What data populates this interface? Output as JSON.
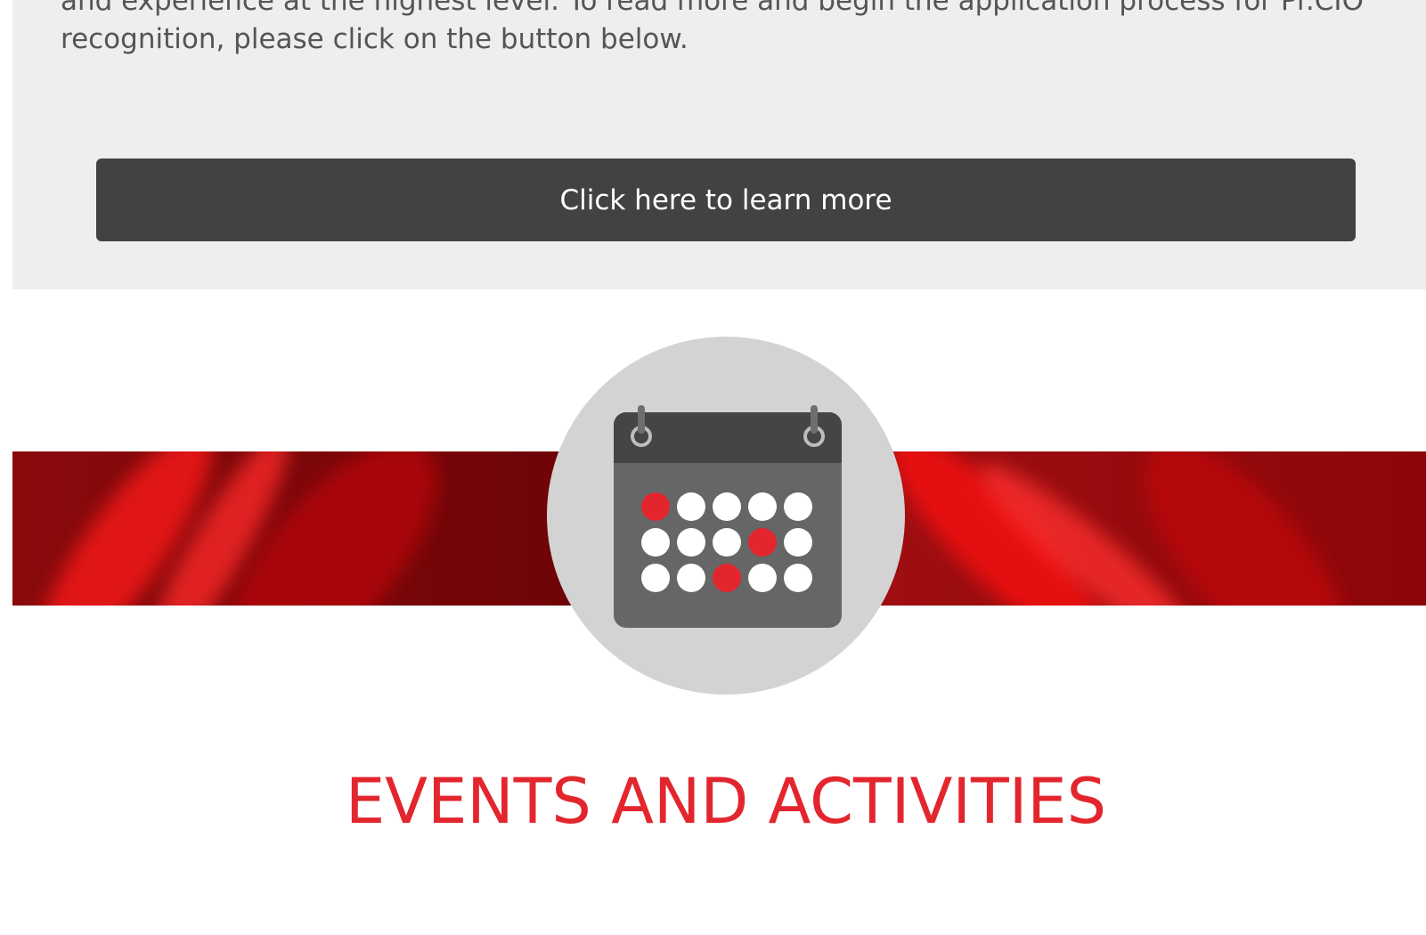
{
  "intro": {
    "text": "and experience at the highest level. To read more and begin the application process for Pr.CIO\nrecognition, please click on the button below."
  },
  "cta": {
    "label": "Click here to learn more"
  },
  "events": {
    "title": "EVENTS AND ACTIVITIES",
    "icon": "calendar-icon"
  },
  "colors": {
    "panel_bg": "#eeeeee",
    "button_bg": "#424242",
    "accent_red": "#e3262e",
    "band_red": "#8a0a0c",
    "icon_circle": "#d3d3d3"
  }
}
